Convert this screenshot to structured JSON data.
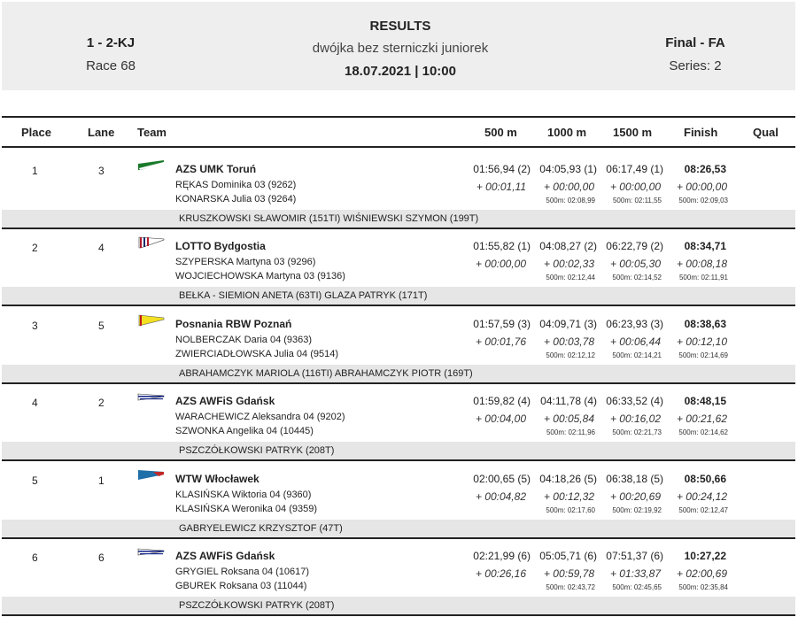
{
  "header": {
    "event_code": "1 - 2-KJ",
    "race": "Race 68",
    "title": "RESULTS",
    "subtitle": "dwójka bez sterniczki juniorek",
    "datetime": "18.07.2021 | 10:00",
    "final": "Final - FA",
    "series": "Series: 2"
  },
  "columns": {
    "place": "Place",
    "lane": "Lane",
    "team": "Team",
    "m500": "500 m",
    "m1000": "1000 m",
    "m1500": "1500 m",
    "finish": "Finish",
    "qual": "Qual"
  },
  "rows": [
    {
      "place": "1",
      "lane": "3",
      "team": "AZS UMK Toruń",
      "flag_icon": "azs-umk-torun-flag-icon",
      "rowers": [
        "RĘKAS  Dominika 03 (9262)",
        "KONARSKA  Julia 03 (9264)"
      ],
      "m500": "01:56,94 (2)",
      "m1000": "04:05,93 (1)",
      "m1500": "06:17,49 (1)",
      "finish": "08:26,53",
      "d500": "+ 00:01,11",
      "d1000": "+ 00:00,00",
      "d1500": "+ 00:00,00",
      "dfinish": "+ 00:00,00",
      "s1000": "500m: 02:08,99",
      "s1500": "500m: 02:11,55",
      "sfinish": "500m: 02:09,03",
      "coach": "KRUSZKOWSKI SŁAWOMIR (151TI) WIŚNIEWSKI SZYMON (199T)"
    },
    {
      "place": "2",
      "lane": "4",
      "team": "LOTTO Bydgostia",
      "flag_icon": "lotto-bydgostia-flag-icon",
      "rowers": [
        "SZYPERSKA  Martyna 03 (9296)",
        "WOJCIECHOWSKA  Martyna 03 (9136)"
      ],
      "m500": "01:55,82 (1)",
      "m1000": "04:08,27 (2)",
      "m1500": "06:22,79 (2)",
      "finish": "08:34,71",
      "d500": "+ 00:00,00",
      "d1000": "+ 00:02,33",
      "d1500": "+ 00:05,30",
      "dfinish": "+ 00:08,18",
      "s1000": "500m: 02:12,44",
      "s1500": "500m: 02:14,52",
      "sfinish": "500m: 02:11,91",
      "coach": "BEŁKA - SIEMION ANETA (63TI) GLAZA PATRYK (171T)"
    },
    {
      "place": "3",
      "lane": "5",
      "team": "Posnania RBW Poznań",
      "flag_icon": "posnania-rbw-flag-icon",
      "rowers": [
        "NOLBERCZAK  Daria 04 (9363)",
        "ZWIERCIADŁOWSKA  Julia 04 (9514)"
      ],
      "m500": "01:57,59 (3)",
      "m1000": "04:09,71 (3)",
      "m1500": "06:23,93 (3)",
      "finish": "08:38,63",
      "d500": "+ 00:01,76",
      "d1000": "+ 00:03,78",
      "d1500": "+ 00:06,44",
      "dfinish": "+ 00:12,10",
      "s1000": "500m: 02:12,12",
      "s1500": "500m: 02:14,21",
      "sfinish": "500m: 02:14,69",
      "coach": "ABRAHAMCZYK MARIOLA (116TI) ABRAHAMCZYK PIOTR (169T)"
    },
    {
      "place": "4",
      "lane": "2",
      "team": "AZS AWFiS Gdańsk",
      "flag_icon": "azs-awfis-gdansk-flag-icon",
      "rowers": [
        "WARACHEWICZ  Aleksandra 04 (9202)",
        "SZWONKA  Angelika 04 (10445)"
      ],
      "m500": "01:59,82 (4)",
      "m1000": "04:11,78 (4)",
      "m1500": "06:33,52 (4)",
      "finish": "08:48,15",
      "d500": "+ 00:04,00",
      "d1000": "+ 00:05,84",
      "d1500": "+ 00:16,02",
      "dfinish": "+ 00:21,62",
      "s1000": "500m: 02:11,96",
      "s1500": "500m: 02:21,73",
      "sfinish": "500m: 02:14,62",
      "coach": "PSZCZÓŁKOWSKI PATRYK (208T)"
    },
    {
      "place": "5",
      "lane": "1",
      "team": "WTW Włocławek",
      "flag_icon": "wtw-wloclawek-flag-icon",
      "rowers": [
        "KLASIŃSKA  Wiktoria 04 (9360)",
        "KLASIŃSKA  Weronika 04 (9359)"
      ],
      "m500": "02:00,65 (5)",
      "m1000": "04:18,26 (5)",
      "m1500": "06:38,18 (5)",
      "finish": "08:50,66",
      "d500": "+ 00:04,82",
      "d1000": "+ 00:12,32",
      "d1500": "+ 00:20,69",
      "dfinish": "+ 00:24,12",
      "s1000": "500m: 02:17,60",
      "s1500": "500m: 02:19,92",
      "sfinish": "500m: 02:12,47",
      "coach": "GABRYELEWICZ KRZYSZTOF (47T)"
    },
    {
      "place": "6",
      "lane": "6",
      "team": "AZS AWFiS Gdańsk",
      "flag_icon": "azs-awfis-gdansk-flag-icon",
      "rowers": [
        "GRYGIEL  Roksana 04 (10617)",
        "GBUREK  Roksana 03 (11044)"
      ],
      "m500": "02:21,99 (6)",
      "m1000": "05:05,71 (6)",
      "m1500": "07:51,37 (6)",
      "finish": "10:27,22",
      "d500": "+ 00:26,16",
      "d1000": "+ 00:59,78",
      "d1500": "+ 01:33,87",
      "dfinish": "+ 02:00,69",
      "s1000": "500m: 02:43,72",
      "s1500": "500m: 02:45,65",
      "sfinish": "500m: 02:35,84",
      "coach": "PSZCZÓŁKOWSKI PATRYK (208T)"
    }
  ]
}
